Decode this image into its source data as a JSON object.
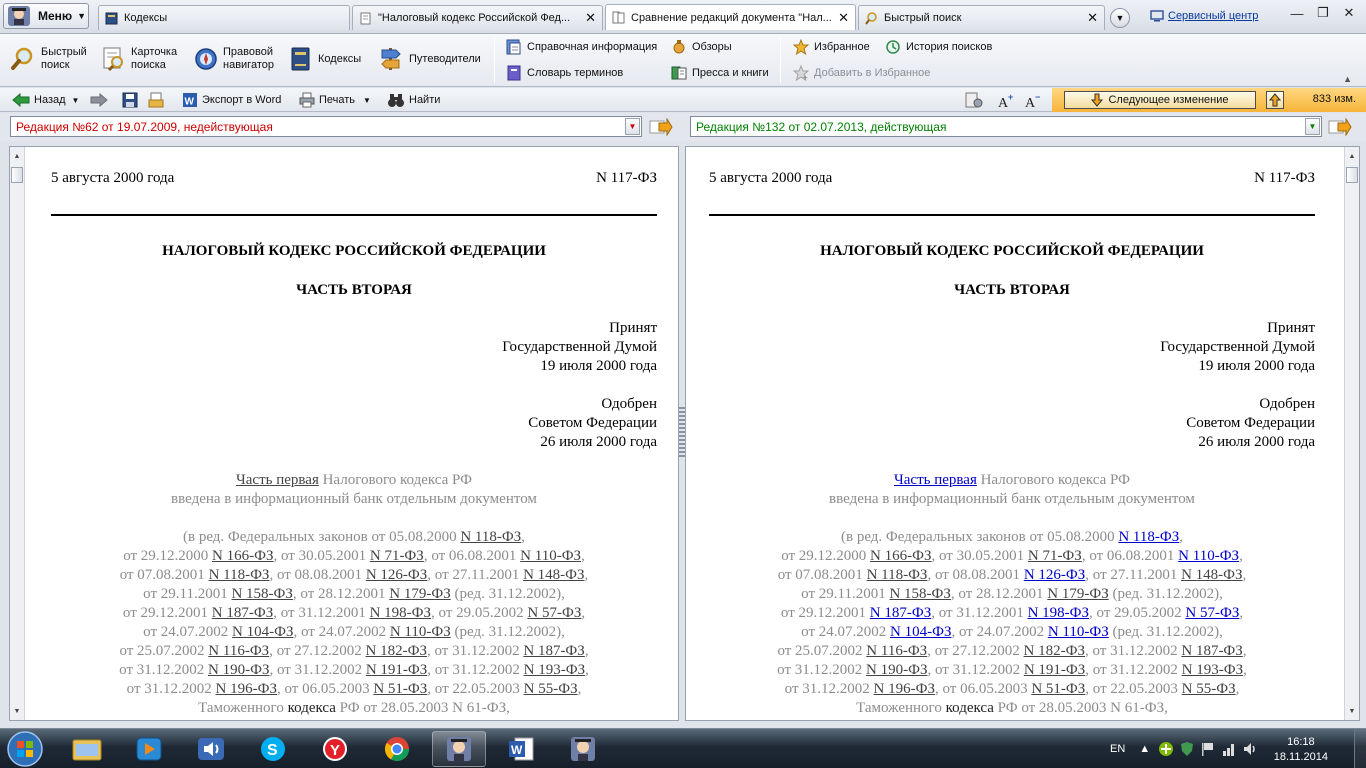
{
  "app": {
    "menu_label": "Меню"
  },
  "tabs": [
    {
      "label": "Кодексы",
      "icon": "book-icon"
    },
    {
      "label": "\"Налоговый кодекс Российской Фед...",
      "icon": "document-icon"
    },
    {
      "label": "Сравнение редакций документа \"Нал...",
      "icon": "compare-icon",
      "active": true
    },
    {
      "label": "Быстрый поиск",
      "icon": "search-icon"
    }
  ],
  "header": {
    "service_center": "Сервисный центр"
  },
  "toolbar": {
    "quick_search": [
      "Быстрый",
      "поиск"
    ],
    "card_search": [
      "Карточка",
      "поиска"
    ],
    "legal_navigator": [
      "Правовой",
      "навигатор"
    ],
    "codes": "Кодексы",
    "guides": "Путеводители",
    "reference_info": "Справочная информация",
    "reviews": "Обзоры",
    "glossary": "Словарь терминов",
    "press": "Пресса и книги",
    "favorites": "Избранное",
    "search_history": "История поисков",
    "add_favorites": "Добавить в Избранное"
  },
  "navbar": {
    "back": "Назад",
    "export_word": "Экспорт в Word",
    "print": "Печать",
    "find": "Найти",
    "next_change": "Следующее изменение",
    "changes_count": "833 изм."
  },
  "editions": {
    "left": "Редакция №62 от 19.07.2009, недействующая",
    "right": "Редакция №132 от 02.07.2013, действующая",
    "left_color": "#cc0000",
    "right_color": "#008000"
  },
  "document": {
    "date": "5 августа 2000 года",
    "number": "N 117-ФЗ",
    "title": "НАЛОГОВЫЙ КОДЕКС РОССИЙСКОЙ ФЕДЕРАЦИИ",
    "part": "ЧАСТЬ ВТОРАЯ",
    "adopted": [
      "Принят",
      "Государственной Думой",
      "19 июля 2000 года"
    ],
    "approved": [
      "Одобрен",
      "Советом Федерации",
      "26 июля 2000 года"
    ],
    "part_one_link": "Часть первая",
    "part_one_rest": " Налогового кодекса РФ",
    "part_one_line2": "введена в информационный банк отдельным документом",
    "amendments": [
      [
        [
          "(в ред. Федеральных законов от 05.08.2000 ",
          0
        ],
        [
          "N 118-ФЗ",
          1
        ],
        [
          ",",
          0
        ]
      ],
      [
        [
          "от 29.12.2000 ",
          0
        ],
        [
          "N 166-ФЗ",
          1
        ],
        [
          ", от 30.05.2001 ",
          0
        ],
        [
          "N 71-ФЗ",
          1
        ],
        [
          ", от 06.08.2001 ",
          0
        ],
        [
          "N 110-ФЗ",
          1
        ],
        [
          ",",
          0
        ]
      ],
      [
        [
          "от 07.08.2001 ",
          0
        ],
        [
          "N 118-ФЗ",
          1
        ],
        [
          ", от 08.08.2001 ",
          0
        ],
        [
          "N 126-ФЗ",
          1
        ],
        [
          ", от 27.11.2001 ",
          0
        ],
        [
          "N 148-ФЗ",
          1
        ],
        [
          ",",
          0
        ]
      ],
      [
        [
          "от 29.11.2001 ",
          0
        ],
        [
          "N 158-ФЗ",
          1
        ],
        [
          ", от 28.12.2001 ",
          0
        ],
        [
          "N 179-ФЗ",
          1
        ],
        [
          " (ред. 31.12.2002),",
          0
        ]
      ],
      [
        [
          "от 29.12.2001 ",
          0
        ],
        [
          "N 187-ФЗ",
          1
        ],
        [
          ", от 31.12.2001 ",
          0
        ],
        [
          "N 198-ФЗ",
          1
        ],
        [
          ", от 29.05.2002 ",
          0
        ],
        [
          "N 57-ФЗ",
          1
        ],
        [
          ",",
          0
        ]
      ],
      [
        [
          "от 24.07.2002 ",
          0
        ],
        [
          "N 104-ФЗ",
          1
        ],
        [
          ", от 24.07.2002 ",
          0
        ],
        [
          "N 110-ФЗ",
          1
        ],
        [
          " (ред. 31.12.2002),",
          0
        ]
      ],
      [
        [
          "от 25.07.2002 ",
          0
        ],
        [
          "N 116-ФЗ",
          1
        ],
        [
          ", от 27.12.2002 ",
          0
        ],
        [
          "N 182-ФЗ",
          1
        ],
        [
          ", от 31.12.2002 ",
          0
        ],
        [
          "N 187-ФЗ",
          1
        ],
        [
          ",",
          0
        ]
      ],
      [
        [
          "от 31.12.2002 ",
          0
        ],
        [
          "N 190-ФЗ",
          1
        ],
        [
          ", от 31.12.2002 ",
          0
        ],
        [
          "N 191-ФЗ",
          1
        ],
        [
          ", от 31.12.2002 ",
          0
        ],
        [
          "N 193-ФЗ",
          1
        ],
        [
          ",",
          0
        ]
      ],
      [
        [
          "от 31.12.2002 ",
          0
        ],
        [
          "N 196-ФЗ",
          1
        ],
        [
          ", от 06.05.2003 ",
          0
        ],
        [
          "N 51-ФЗ",
          1
        ],
        [
          ", от 22.05.2003 ",
          0
        ],
        [
          "N 55-ФЗ",
          1
        ],
        [
          ",",
          0
        ]
      ],
      [
        [
          "Таможенного ",
          0
        ],
        [
          "кодекса",
          2
        ],
        [
          " РФ от 28.05.2003 N 61-ФЗ,",
          0
        ]
      ]
    ],
    "right_blue_links": [
      "N 118-ФЗ",
      "N 110-ФЗ",
      "N 126-ФЗ",
      "N 187-ФЗ",
      "N 198-ФЗ",
      "N 57-ФЗ",
      "N 104-ФЗ",
      "N 110-ФЗ"
    ]
  },
  "taskbar": {
    "language": "EN",
    "time": "16:18",
    "date": "18.11.2014"
  }
}
